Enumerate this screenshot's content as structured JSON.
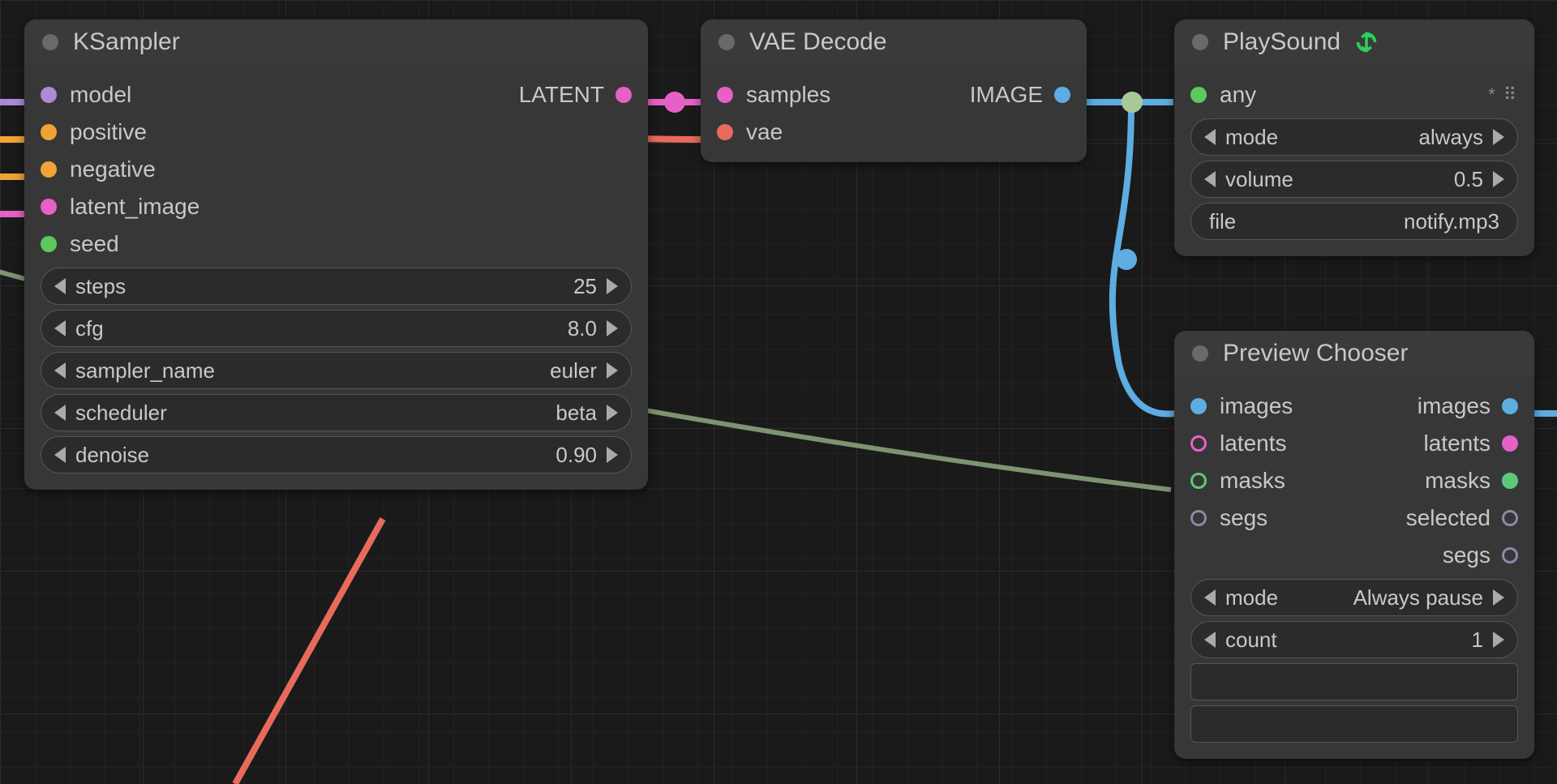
{
  "nodes": {
    "ksampler": {
      "title": "KSampler",
      "inputs": {
        "model": "model",
        "positive": "positive",
        "negative": "negative",
        "latent_image": "latent_image",
        "seed": "seed"
      },
      "outputs": {
        "latent": "LATENT"
      },
      "widgets": {
        "steps": {
          "label": "steps",
          "value": "25"
        },
        "cfg": {
          "label": "cfg",
          "value": "8.0"
        },
        "sampler_name": {
          "label": "sampler_name",
          "value": "euler"
        },
        "scheduler": {
          "label": "scheduler",
          "value": "beta"
        },
        "denoise": {
          "label": "denoise",
          "value": "0.90"
        }
      }
    },
    "vae_decode": {
      "title": "VAE Decode",
      "inputs": {
        "samples": "samples",
        "vae": "vae"
      },
      "outputs": {
        "image": "IMAGE"
      }
    },
    "playsound": {
      "title": "PlaySound",
      "inputs": {
        "any": "any"
      },
      "widgets": {
        "mode": {
          "label": "mode",
          "value": "always"
        },
        "volume": {
          "label": "volume",
          "value": "0.5"
        },
        "file": {
          "label": "file",
          "value": "notify.mp3"
        }
      },
      "extras": "* ⠿"
    },
    "preview_chooser": {
      "title": "Preview Chooser",
      "inputs": {
        "images": "images",
        "latents": "latents",
        "masks": "masks",
        "segs": "segs"
      },
      "outputs": {
        "images": "images",
        "latents": "latents",
        "masks": "masks",
        "selected": "selected",
        "segs": "segs"
      },
      "widgets": {
        "mode": {
          "label": "mode",
          "value": "Always pause"
        },
        "count": {
          "label": "count",
          "value": "1"
        }
      }
    }
  },
  "colors": {
    "latent": "#e661c5",
    "image": "#5dade2",
    "vae": "#e86a5c",
    "any": "#a8c89a",
    "green_accent": "#2bd15f"
  }
}
